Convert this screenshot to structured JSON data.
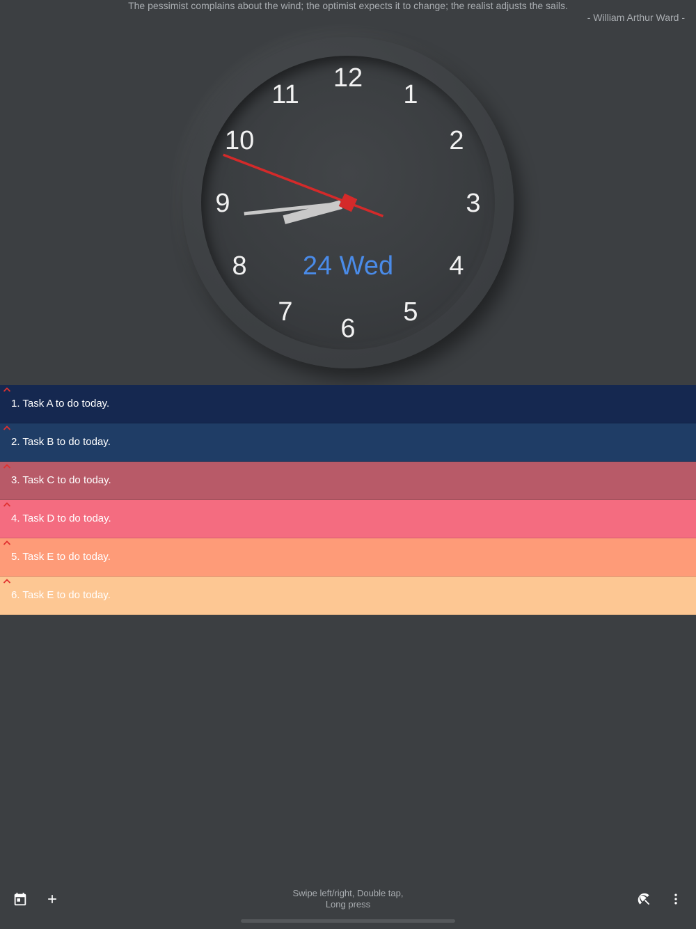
{
  "quote": {
    "text": "The pessimist complains about the wind; the optimist expects it to change; the realist adjusts the sails.",
    "author": "- William Arthur Ward -"
  },
  "clock": {
    "numbers": [
      "12",
      "1",
      "2",
      "3",
      "4",
      "5",
      "6",
      "7",
      "8",
      "9",
      "10",
      "11"
    ],
    "date_label": "24 Wed",
    "time": {
      "hour": 8,
      "minute": 40,
      "second": 49
    },
    "colors": {
      "date": "#4a8be8",
      "second_hand": "#d42a2a",
      "hands": "#c9c9c9"
    }
  },
  "tasks": [
    {
      "label": "1. Task A to do today.",
      "color": "#152850"
    },
    {
      "label": "2. Task B to do today.",
      "color": "#1f3d66"
    },
    {
      "label": "3. Task C to do today.",
      "color": "#b85a68"
    },
    {
      "label": "4. Task D to do today.",
      "color": "#f46c80"
    },
    {
      "label": "5. Task E to do today.",
      "color": "#fe9b78"
    },
    {
      "label": "6. Task E to do today.",
      "color": "#fdc793"
    }
  ],
  "toolbar": {
    "hint": [
      "Swipe left/right, Double tap,",
      "Long press"
    ],
    "icons": [
      "calendar-icon",
      "add-icon",
      "beach-umbrella-icon",
      "more-vert-icon"
    ]
  },
  "accent": {
    "caret": "#e0302f"
  }
}
